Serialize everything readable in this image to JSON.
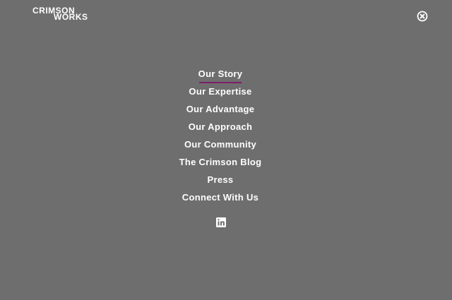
{
  "logo": {
    "line1": "CRIMSON",
    "line2": "WORKS"
  },
  "menu": {
    "items": [
      {
        "label": "Our Story",
        "active": true
      },
      {
        "label": "Our Expertise",
        "active": false
      },
      {
        "label": "Our Advantage",
        "active": false
      },
      {
        "label": "Our Approach",
        "active": false
      },
      {
        "label": "Our Community",
        "active": false
      },
      {
        "label": "The Crimson Blog",
        "active": false
      },
      {
        "label": "Press",
        "active": false
      },
      {
        "label": "Connect With Us",
        "active": false
      }
    ]
  },
  "icons": {
    "close": "close-circle-icon",
    "social": "linkedin-icon"
  },
  "colors": {
    "background": "#6e6e6e",
    "text": "#ffffff",
    "accent": "#7b1e6a"
  }
}
